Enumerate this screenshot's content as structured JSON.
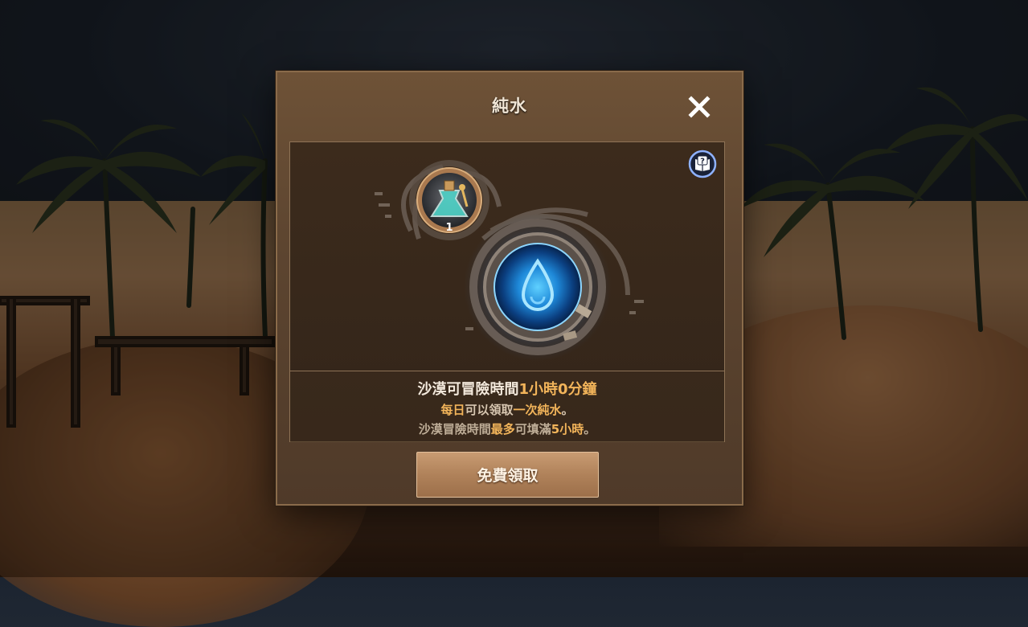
{
  "dialog": {
    "title": "純水",
    "close_icon": "close-icon",
    "help_icon": "help-book-icon"
  },
  "item": {
    "icon": "water-potion-icon",
    "count": "1"
  },
  "emblem": {
    "icon": "water-drop-icon"
  },
  "info": {
    "line1_prefix": "沙漠可冒險時間",
    "line1_value": "1小時0分鐘",
    "line2_hl1": "每日",
    "line2_mid": "可以領取",
    "line2_hl2": "一次純水",
    "line2_end": "。",
    "line3_prefix": "沙漠冒險時間",
    "line3_hl1": "最多",
    "line3_mid": "可填滿",
    "line3_hl2": "5小時",
    "line3_end": "。"
  },
  "button": {
    "label": "免費領取"
  },
  "colors": {
    "highlight": "#f2b45a",
    "button": "#b0825a",
    "frame": "#8e7356"
  }
}
